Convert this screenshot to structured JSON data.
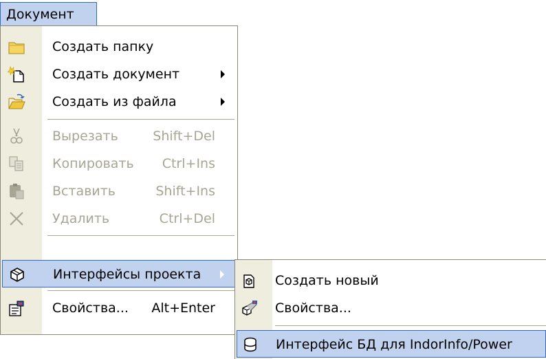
{
  "menubar": {
    "title": "Документ"
  },
  "main_menu": {
    "items": [
      {
        "label": "Создать папку",
        "icon": "folder-icon"
      },
      {
        "label": "Создать документ",
        "icon": "new-document-icon",
        "submenu": true
      },
      {
        "label": "Создать из файла",
        "icon": "open-folder-icon",
        "submenu": true
      },
      {
        "label": "Вырезать",
        "shortcut": "Shift+Del",
        "icon": "cut-icon",
        "disabled": true
      },
      {
        "label": "Копировать",
        "shortcut": "Ctrl+Ins",
        "icon": "copy-icon",
        "disabled": true
      },
      {
        "label": "Вставить",
        "shortcut": "Shift+Ins",
        "icon": "paste-icon",
        "disabled": true
      },
      {
        "label": "Удалить",
        "shortcut": "Ctrl+Del",
        "icon": "delete-icon",
        "disabled": true
      },
      {
        "label": "Интерфейсы проекта",
        "icon": "project-interfaces-icon",
        "submenu": true,
        "highlighted": true
      },
      {
        "label": "Свойства...",
        "shortcut": "Alt+Enter",
        "icon": "properties-icon"
      }
    ]
  },
  "sub_menu": {
    "items": [
      {
        "label": "Создать новый",
        "icon": "create-new-icon"
      },
      {
        "label": "Свойства...",
        "icon": "interface-properties-icon"
      },
      {
        "label": "Интерфейс БД для IndorInfo/Power",
        "icon": "database-icon",
        "highlighted": true
      }
    ]
  },
  "colors": {
    "highlight_bg": "#c1d2ee",
    "highlight_border": "#316ac5",
    "gutter": "#efedde",
    "disabled_text": "#a7a594"
  }
}
